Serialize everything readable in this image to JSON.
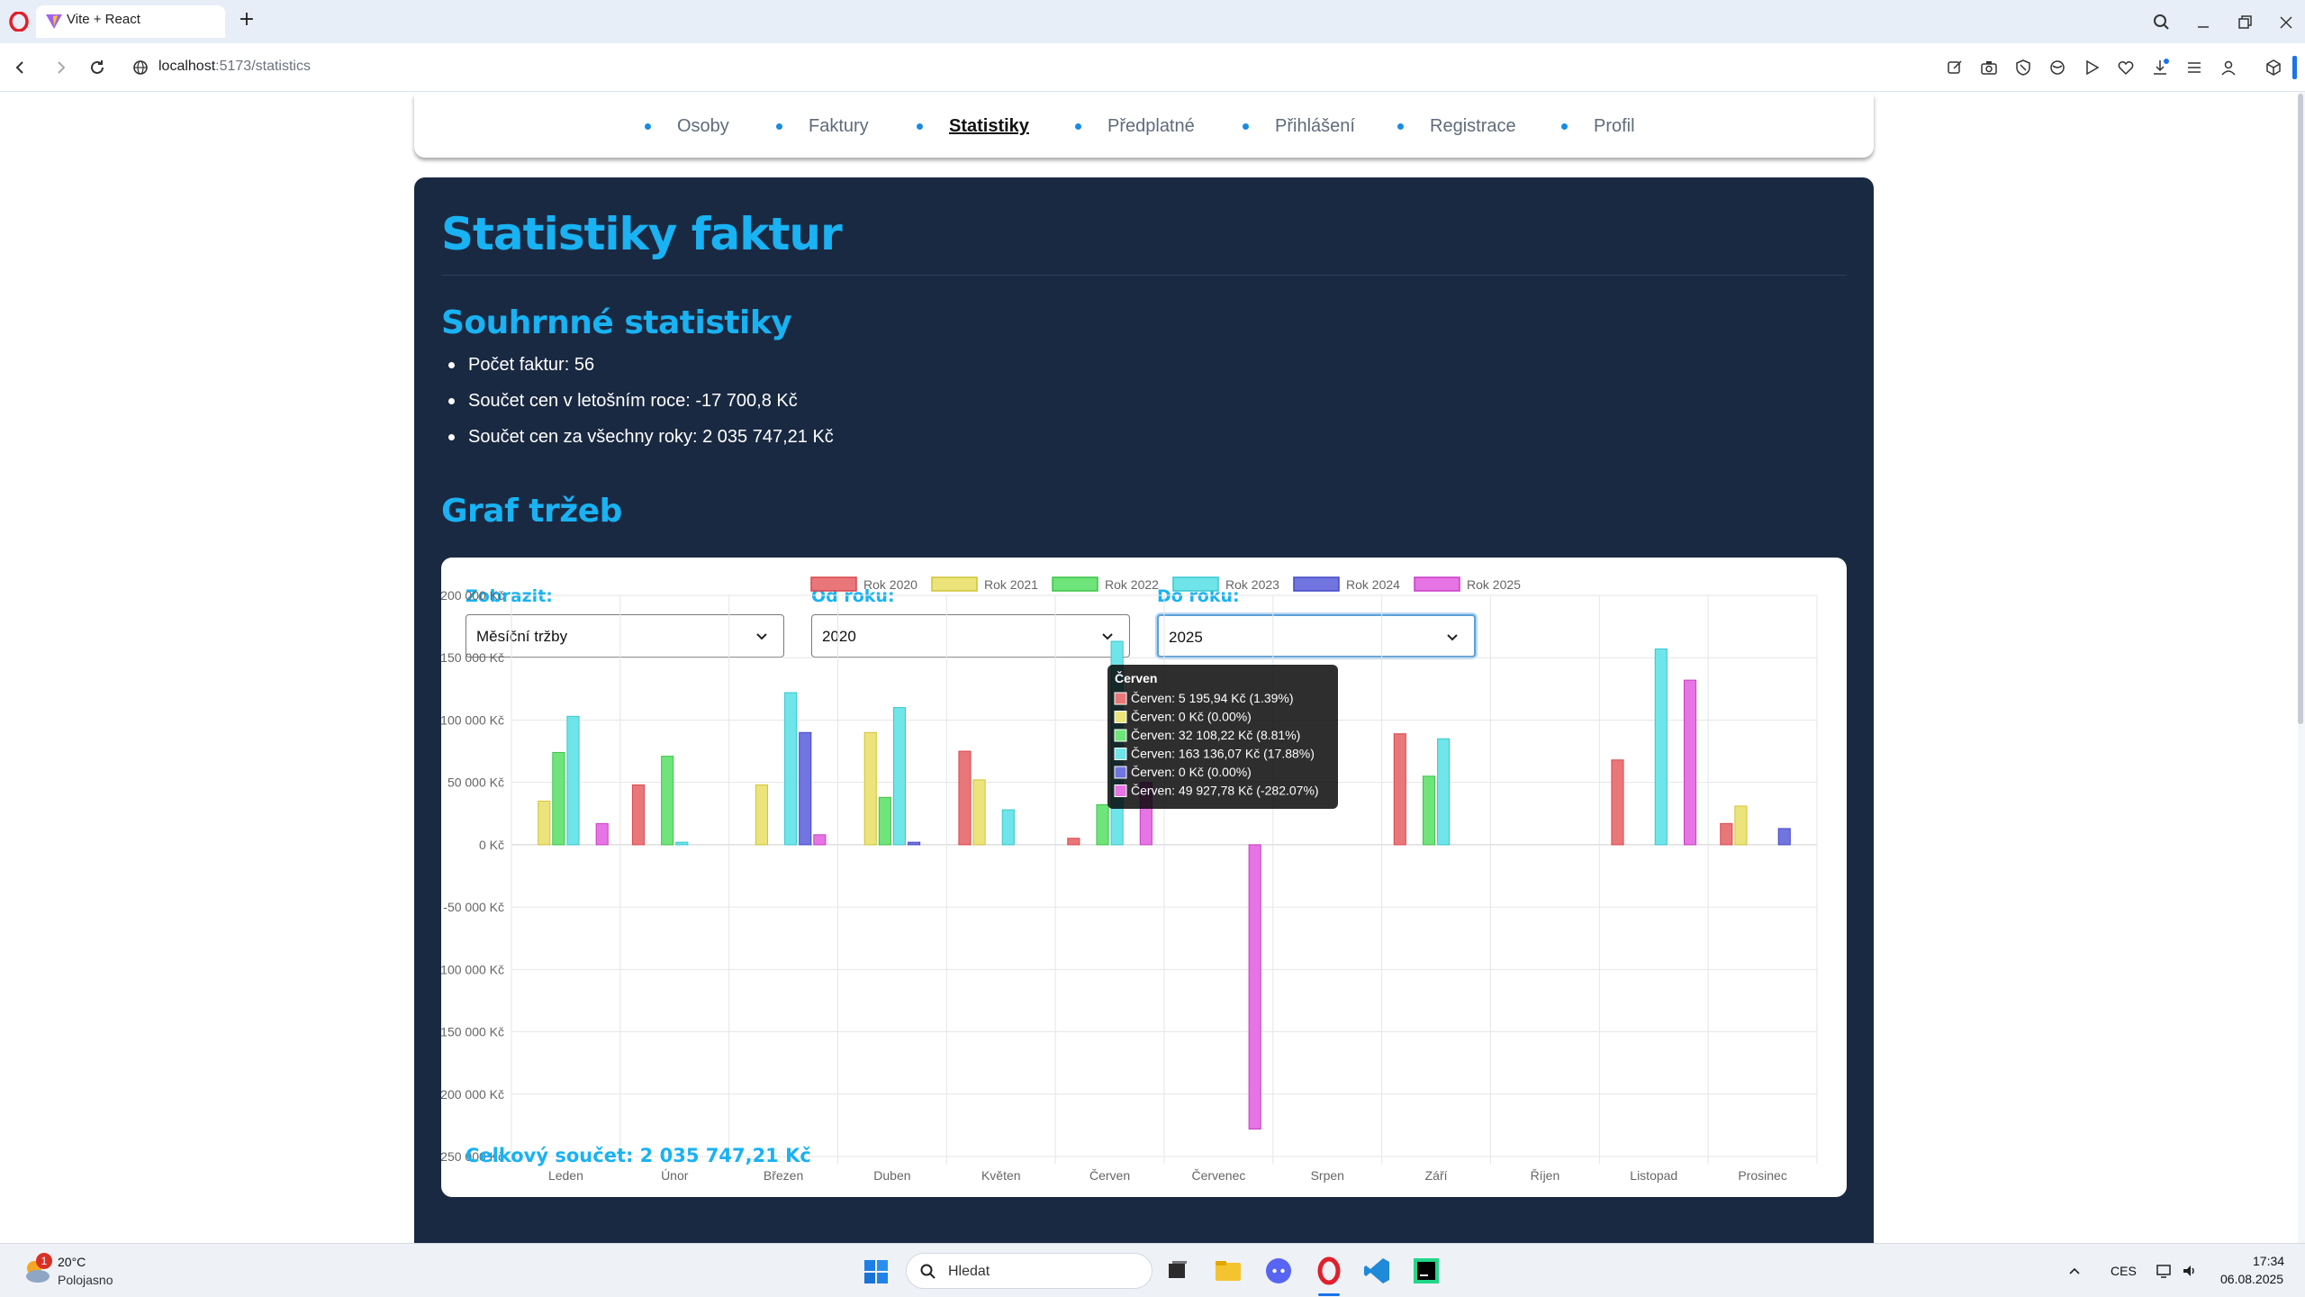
{
  "browser": {
    "tab_title": "Vite + React",
    "url_host": "localhost",
    "url_path": ":5173/statistics"
  },
  "nav": {
    "items": [
      {
        "label": "Osoby",
        "active": false
      },
      {
        "label": "Faktury",
        "active": false
      },
      {
        "label": "Statistiky",
        "active": true
      },
      {
        "label": "Předplatné",
        "active": false
      },
      {
        "label": "Přihlášení",
        "active": false
      },
      {
        "label": "Registrace",
        "active": false
      },
      {
        "label": "Profil",
        "active": false
      }
    ]
  },
  "page": {
    "title": "Statistiky faktur",
    "summary_heading": "Souhrnné statistiky",
    "summary": [
      "Počet faktur: 56",
      "Součet cen v letošním roce: -17 700,8 Kč",
      "Součet cen za všechny roky: 2 035 747,21 Kč"
    ],
    "chart_heading": "Graf tržeb",
    "filters": {
      "show_label": "Zobrazit:",
      "show_value": "Měsíční tržby",
      "from_label": "Od roku:",
      "from_value": "2020",
      "to_label": "Do roku:",
      "to_value": "2025"
    },
    "total": "Celkový součet: 2 035 747,21 Kč"
  },
  "colors": {
    "accent": "#19b2f2",
    "panel_bg": "#1a2942"
  },
  "chart_data": {
    "type": "bar",
    "categories": [
      "Leden",
      "Únor",
      "Březen",
      "Duben",
      "Květen",
      "Červen",
      "Červenec",
      "Srpen",
      "Září",
      "Říjen",
      "Listopad",
      "Prosinec"
    ],
    "y_ticks": [
      "200 000 Kč",
      "150 000 Kč",
      "100 000 Kč",
      "50 000 Kč",
      "0 Kč",
      "-50 000 Kč",
      "-100 000 Kč",
      "-150 000 Kč",
      "-200 000 Kč",
      "-250 000 Kč"
    ],
    "ylim": [
      -250000,
      200000
    ],
    "grid": true,
    "legend_position": "top",
    "series": [
      {
        "name": "Rok 2020",
        "fill": "#e9777a",
        "stroke": "#d9474d",
        "values": [
          0,
          48000,
          0,
          0,
          75000,
          5195.94,
          0,
          0,
          89000,
          0,
          68000,
          17000
        ]
      },
      {
        "name": "Rok 2021",
        "fill": "#ece47a",
        "stroke": "#cfc338",
        "values": [
          35000,
          0,
          48000,
          90000,
          52000,
          0,
          0,
          0,
          0,
          0,
          0,
          31000
        ]
      },
      {
        "name": "Rok 2022",
        "fill": "#6fe47a",
        "stroke": "#3cc44a",
        "values": [
          74000,
          71000,
          0,
          38000,
          0,
          32108.22,
          0,
          0,
          55000,
          0,
          0,
          0
        ]
      },
      {
        "name": "Rok 2023",
        "fill": "#6fe5ea",
        "stroke": "#36c7cf",
        "values": [
          103000,
          2000,
          122000,
          110000,
          28000,
          163136.07,
          0,
          0,
          85000,
          0,
          157000,
          0
        ]
      },
      {
        "name": "Rok 2024",
        "fill": "#7175e0",
        "stroke": "#4448c8",
        "values": [
          0,
          0,
          90000,
          2000,
          0,
          0,
          0,
          0,
          0,
          0,
          0,
          13000
        ]
      },
      {
        "name": "Rok 2025",
        "fill": "#e674e4",
        "stroke": "#c83fc6",
        "values": [
          17000,
          0,
          8000,
          0,
          0,
          49927.78,
          -228000,
          0,
          0,
          0,
          132000,
          0
        ]
      }
    ],
    "tooltip": {
      "title": "Červen",
      "lines": [
        "Červen: 5 195,94 Kč (1.39%)",
        "Červen: 0 Kč (0.00%)",
        "Červen: 32 108,22 Kč (8.81%)",
        "Červen: 163 136,07 Kč (17.88%)",
        "Červen: 0 Kč (0.00%)",
        "Červen: 49 927,78 Kč (-282.07%)"
      ]
    }
  },
  "taskbar": {
    "weather_badge": "1",
    "weather_temp": "20°C",
    "weather_desc": "Polojasno",
    "search_placeholder": "Hledat",
    "lang": "CES",
    "time": "17:34",
    "date": "06.08.2025"
  }
}
